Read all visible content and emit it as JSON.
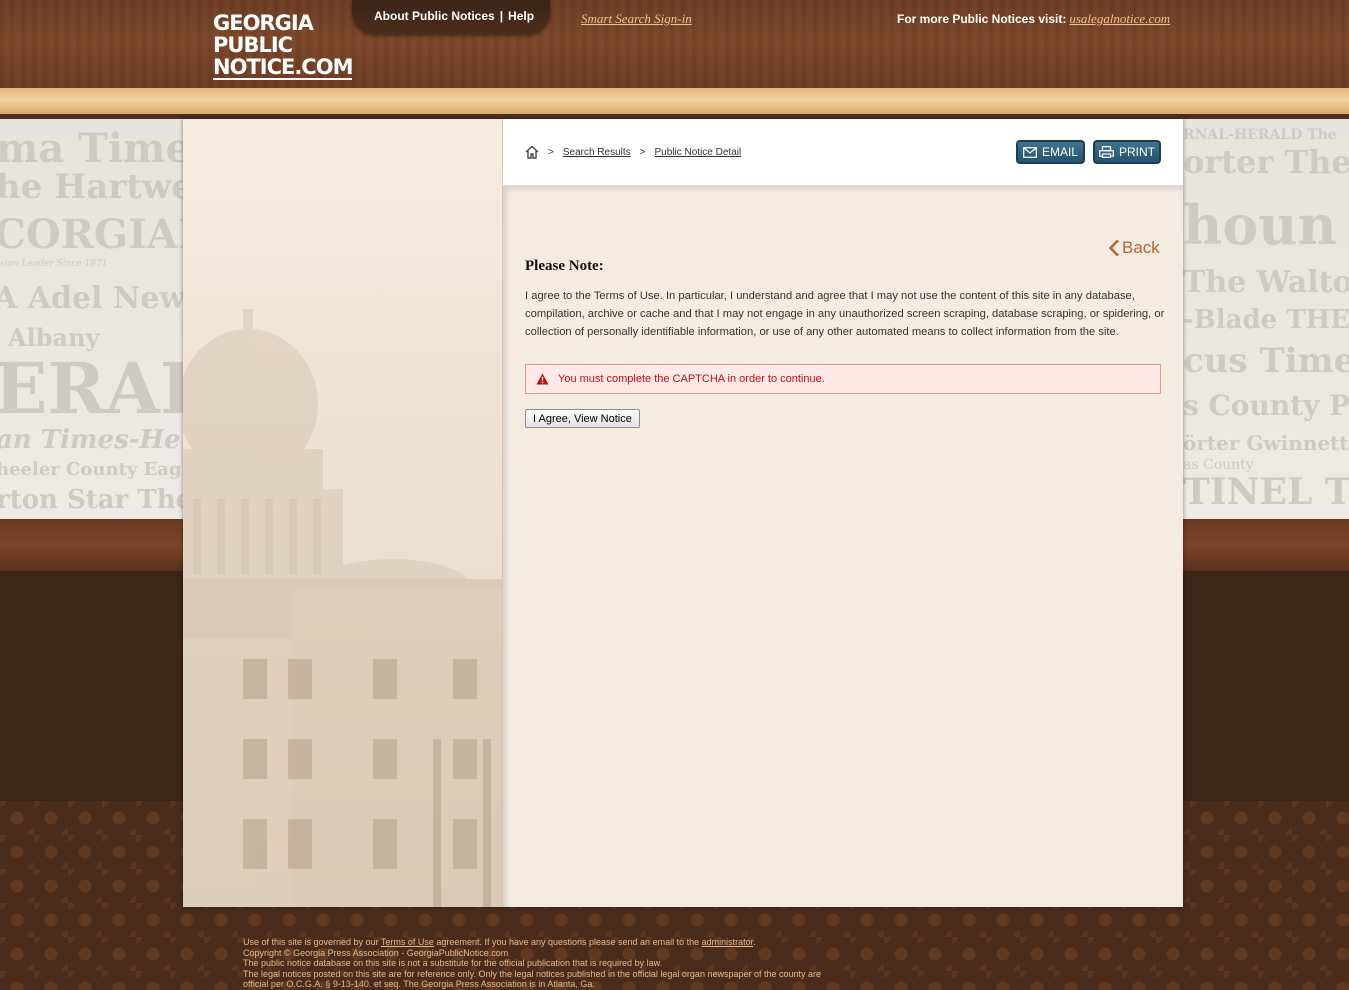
{
  "header": {
    "logo_line1": "GEORGIA",
    "logo_line2": "PUBLIC",
    "logo_line3": "NOTICE.COM",
    "nav_about": "About Public Notices",
    "nav_separator": "|",
    "nav_help": "Help",
    "smart_search": "Smart Search Sign-in",
    "more_label": "For more Public Notices visit:",
    "more_link": "usalegalnotice.com"
  },
  "background": {
    "mastheads_left": [
      "ma Times",
      "he Hartwe",
      "CORGIAN",
      "sion Leader Since 1871",
      "A Adel News",
      "Albany",
      "ERALD",
      "an Times-He",
      "heeler County Eagle",
      "rton Star  The"
    ],
    "mastheads_right": [
      "RNAL-HERALD  The",
      "orter  The Bald",
      "houn T",
      "The Walton",
      "-Blade  THE",
      "cus Times",
      "s County Pro",
      "örter Gwinnett",
      "as County",
      "TINEL  THE"
    ]
  },
  "breadcrumb": {
    "separator": ">",
    "search_results": "Search Results",
    "detail": "Public Notice Detail"
  },
  "toolbar": {
    "email_label": "EMAIL",
    "print_label": "PRINT"
  },
  "content": {
    "back_label": "Back",
    "note_title": "Please Note:",
    "terms_text": "I agree to the Terms of Use. In particular, I understand and agree that I may not use the content of this site in any database, compilation, archive or cache and that I may not engage in any unauthorized screen scraping, database scraping, or spidering, or collection of personally identifiable information, or use of any other automated means to collect information from the site.",
    "captcha_error": "You must complete the CAPTCHA in order to continue.",
    "agree_button": "I Agree, View Notice"
  },
  "footer": {
    "line1_pre": "Use of this site is governed by our ",
    "line1_link": "Terms of Use",
    "line1_mid": " agreement. If you have any questions please send an email to the ",
    "line1_link2": "administrator",
    "line1_post": ".",
    "line2": "Copyright © Georgia Press Association - GeorgiaPublicNotice.com",
    "line3": "The public notice database on this site is not a substitute for the official publication that is required by law.",
    "line4": "The legal notices posted on this site are for reference only. Only the legal notices published in the official legal organ newspaper of the county are",
    "line5": "official per O.C.G.A. § 9-13-140. et seq. The Georgia Press Association is in Atlanta, Ga."
  },
  "colors": {
    "wood": "#7a4628",
    "tan_band": "#f4d19f",
    "teal_button": "#2f6280",
    "error_red": "#c40d0d",
    "back_orange": "#b76332"
  }
}
